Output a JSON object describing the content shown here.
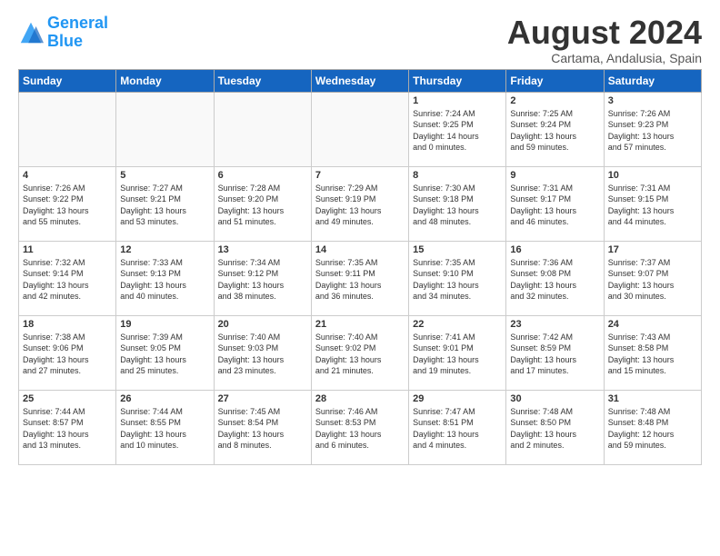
{
  "logo": {
    "line1": "General",
    "line2": "Blue"
  },
  "title": "August 2024",
  "subtitle": "Cartama, Andalusia, Spain",
  "days_of_week": [
    "Sunday",
    "Monday",
    "Tuesday",
    "Wednesday",
    "Thursday",
    "Friday",
    "Saturday"
  ],
  "weeks": [
    [
      {
        "day": "",
        "info": ""
      },
      {
        "day": "",
        "info": ""
      },
      {
        "day": "",
        "info": ""
      },
      {
        "day": "",
        "info": ""
      },
      {
        "day": "1",
        "info": "Sunrise: 7:24 AM\nSunset: 9:25 PM\nDaylight: 14 hours\nand 0 minutes."
      },
      {
        "day": "2",
        "info": "Sunrise: 7:25 AM\nSunset: 9:24 PM\nDaylight: 13 hours\nand 59 minutes."
      },
      {
        "day": "3",
        "info": "Sunrise: 7:26 AM\nSunset: 9:23 PM\nDaylight: 13 hours\nand 57 minutes."
      }
    ],
    [
      {
        "day": "4",
        "info": "Sunrise: 7:26 AM\nSunset: 9:22 PM\nDaylight: 13 hours\nand 55 minutes."
      },
      {
        "day": "5",
        "info": "Sunrise: 7:27 AM\nSunset: 9:21 PM\nDaylight: 13 hours\nand 53 minutes."
      },
      {
        "day": "6",
        "info": "Sunrise: 7:28 AM\nSunset: 9:20 PM\nDaylight: 13 hours\nand 51 minutes."
      },
      {
        "day": "7",
        "info": "Sunrise: 7:29 AM\nSunset: 9:19 PM\nDaylight: 13 hours\nand 49 minutes."
      },
      {
        "day": "8",
        "info": "Sunrise: 7:30 AM\nSunset: 9:18 PM\nDaylight: 13 hours\nand 48 minutes."
      },
      {
        "day": "9",
        "info": "Sunrise: 7:31 AM\nSunset: 9:17 PM\nDaylight: 13 hours\nand 46 minutes."
      },
      {
        "day": "10",
        "info": "Sunrise: 7:31 AM\nSunset: 9:15 PM\nDaylight: 13 hours\nand 44 minutes."
      }
    ],
    [
      {
        "day": "11",
        "info": "Sunrise: 7:32 AM\nSunset: 9:14 PM\nDaylight: 13 hours\nand 42 minutes."
      },
      {
        "day": "12",
        "info": "Sunrise: 7:33 AM\nSunset: 9:13 PM\nDaylight: 13 hours\nand 40 minutes."
      },
      {
        "day": "13",
        "info": "Sunrise: 7:34 AM\nSunset: 9:12 PM\nDaylight: 13 hours\nand 38 minutes."
      },
      {
        "day": "14",
        "info": "Sunrise: 7:35 AM\nSunset: 9:11 PM\nDaylight: 13 hours\nand 36 minutes."
      },
      {
        "day": "15",
        "info": "Sunrise: 7:35 AM\nSunset: 9:10 PM\nDaylight: 13 hours\nand 34 minutes."
      },
      {
        "day": "16",
        "info": "Sunrise: 7:36 AM\nSunset: 9:08 PM\nDaylight: 13 hours\nand 32 minutes."
      },
      {
        "day": "17",
        "info": "Sunrise: 7:37 AM\nSunset: 9:07 PM\nDaylight: 13 hours\nand 30 minutes."
      }
    ],
    [
      {
        "day": "18",
        "info": "Sunrise: 7:38 AM\nSunset: 9:06 PM\nDaylight: 13 hours\nand 27 minutes."
      },
      {
        "day": "19",
        "info": "Sunrise: 7:39 AM\nSunset: 9:05 PM\nDaylight: 13 hours\nand 25 minutes."
      },
      {
        "day": "20",
        "info": "Sunrise: 7:40 AM\nSunset: 9:03 PM\nDaylight: 13 hours\nand 23 minutes."
      },
      {
        "day": "21",
        "info": "Sunrise: 7:40 AM\nSunset: 9:02 PM\nDaylight: 13 hours\nand 21 minutes."
      },
      {
        "day": "22",
        "info": "Sunrise: 7:41 AM\nSunset: 9:01 PM\nDaylight: 13 hours\nand 19 minutes."
      },
      {
        "day": "23",
        "info": "Sunrise: 7:42 AM\nSunset: 8:59 PM\nDaylight: 13 hours\nand 17 minutes."
      },
      {
        "day": "24",
        "info": "Sunrise: 7:43 AM\nSunset: 8:58 PM\nDaylight: 13 hours\nand 15 minutes."
      }
    ],
    [
      {
        "day": "25",
        "info": "Sunrise: 7:44 AM\nSunset: 8:57 PM\nDaylight: 13 hours\nand 13 minutes."
      },
      {
        "day": "26",
        "info": "Sunrise: 7:44 AM\nSunset: 8:55 PM\nDaylight: 13 hours\nand 10 minutes."
      },
      {
        "day": "27",
        "info": "Sunrise: 7:45 AM\nSunset: 8:54 PM\nDaylight: 13 hours\nand 8 minutes."
      },
      {
        "day": "28",
        "info": "Sunrise: 7:46 AM\nSunset: 8:53 PM\nDaylight: 13 hours\nand 6 minutes."
      },
      {
        "day": "29",
        "info": "Sunrise: 7:47 AM\nSunset: 8:51 PM\nDaylight: 13 hours\nand 4 minutes."
      },
      {
        "day": "30",
        "info": "Sunrise: 7:48 AM\nSunset: 8:50 PM\nDaylight: 13 hours\nand 2 minutes."
      },
      {
        "day": "31",
        "info": "Sunrise: 7:48 AM\nSunset: 8:48 PM\nDaylight: 12 hours\nand 59 minutes."
      }
    ]
  ]
}
